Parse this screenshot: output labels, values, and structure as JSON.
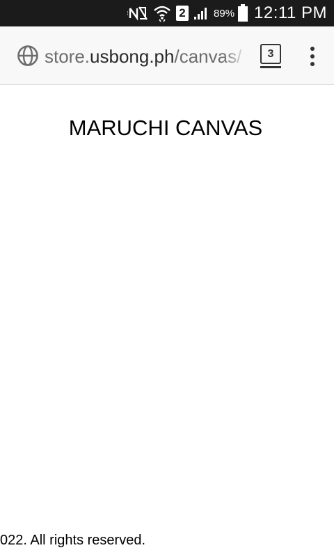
{
  "status_bar": {
    "icons": [
      "nfc-icon",
      "wifi-icon",
      "sim-icon",
      "signal-icon",
      "battery-icon"
    ],
    "sim_slot": "2",
    "battery_percent": "89%",
    "time": "12:11 PM"
  },
  "browser": {
    "url_scheme_part": "store.",
    "url_host_part": "usbong.ph",
    "url_path_part": "/canvas/",
    "tab_count": "3",
    "colors": {
      "toolbar_bg": "#f8f8f8",
      "status_bar_bg": "#1b1b1b"
    }
  },
  "page": {
    "title": "MARUCHI CANVAS",
    "footer": "022. All rights reserved."
  }
}
